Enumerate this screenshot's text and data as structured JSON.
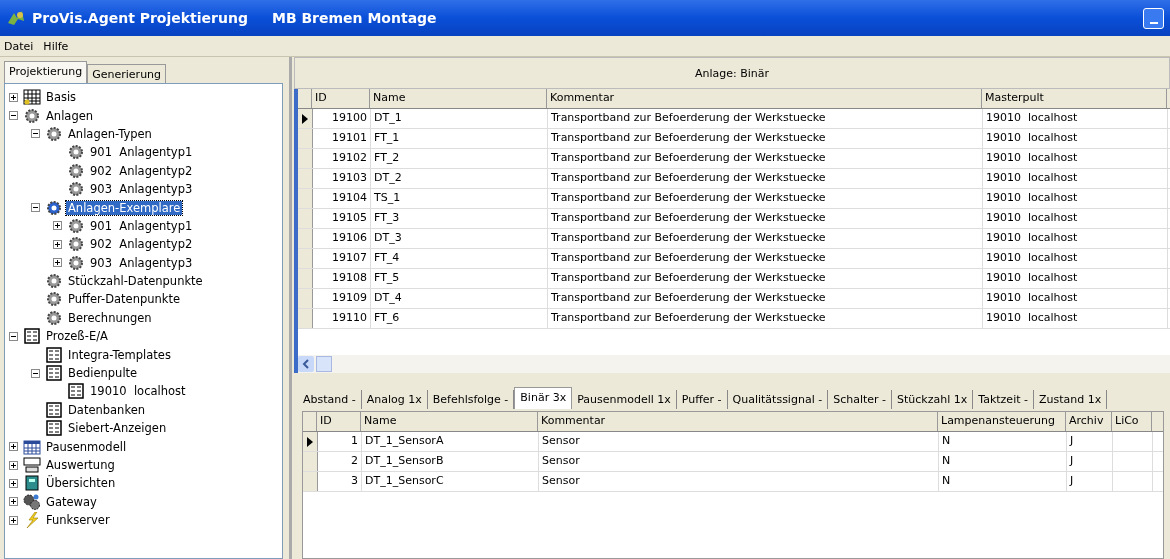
{
  "window": {
    "title": "ProVis.Agent Projektierung",
    "subtitle": "MB Bremen Montage"
  },
  "menu": [
    "Datei",
    "Hilfe"
  ],
  "left_tabs": [
    {
      "label": "Projektierung",
      "selected": true
    },
    {
      "label": "Generierung",
      "selected": false
    }
  ],
  "tree": [
    {
      "label": "Basis",
      "kind": "grid",
      "expanded": false,
      "selected": false
    },
    {
      "label": "Anlagen",
      "kind": "gear",
      "expanded": true,
      "selected": false,
      "children": [
        {
          "label": "Anlagen-Typen",
          "kind": "gear",
          "expanded": true,
          "selected": false,
          "children": [
            {
              "label": "901  Anlagentyp1",
              "kind": "gear",
              "selected": false
            },
            {
              "label": "902  Anlagentyp2",
              "kind": "gear",
              "selected": false
            },
            {
              "label": "903  Anlagentyp3",
              "kind": "gear",
              "selected": false
            }
          ]
        },
        {
          "label": "Anlagen-Exemplare",
          "kind": "gear",
          "expanded": true,
          "selected": true,
          "children": [
            {
              "label": "901  Anlagentyp1",
              "kind": "gear",
              "expanded": false,
              "selected": false
            },
            {
              "label": "902  Anlagentyp2",
              "kind": "gear",
              "expanded": false,
              "selected": false
            },
            {
              "label": "903  Anlagentyp3",
              "kind": "gear",
              "expanded": false,
              "selected": false
            }
          ]
        },
        {
          "label": "Stückzahl-Datenpunkte",
          "kind": "gear",
          "selected": false
        },
        {
          "label": "Puffer-Datenpunkte",
          "kind": "gear",
          "selected": false
        },
        {
          "label": "Berechnungen",
          "kind": "gear",
          "selected": false
        }
      ]
    },
    {
      "label": "Prozeß-E/A",
      "kind": "list",
      "expanded": true,
      "selected": false,
      "children": [
        {
          "label": "Integra-Templates",
          "kind": "list",
          "selected": false
        },
        {
          "label": "Bedienpulte",
          "kind": "list",
          "expanded": true,
          "selected": false,
          "children": [
            {
              "label": "19010  localhost",
              "kind": "list",
              "selected": false
            }
          ]
        },
        {
          "label": "Datenbanken",
          "kind": "list",
          "selected": false
        },
        {
          "label": "Siebert-Anzeigen",
          "kind": "list",
          "selected": false
        }
      ]
    },
    {
      "label": "Pausenmodell",
      "kind": "calendar",
      "expanded": false,
      "selected": false
    },
    {
      "label": "Auswertung",
      "kind": "terminal",
      "expanded": false,
      "selected": false
    },
    {
      "label": "Übersichten",
      "kind": "book",
      "expanded": false,
      "selected": false
    },
    {
      "label": "Gateway",
      "kind": "network",
      "expanded": false,
      "selected": false
    },
    {
      "label": "Funkserver",
      "kind": "bolt",
      "expanded": false,
      "selected": false
    }
  ],
  "panel_title": "Anlage: Binär",
  "upper_table": {
    "columns": [
      "ID",
      "Name",
      "Kommentar",
      "Masterpult"
    ],
    "rows": [
      {
        "cells": [
          "19100",
          "DT_1",
          "Transportband zur Befoerderung der Werkstuecke",
          "19010  localhost"
        ],
        "selected": true
      },
      {
        "cells": [
          "19101",
          "FT_1",
          "Transportband zur Befoerderung der Werkstuecke",
          "19010  localhost"
        ],
        "selected": false
      },
      {
        "cells": [
          "19102",
          "FT_2",
          "Transportband zur Befoerderung der Werkstuecke",
          "19010  localhost"
        ],
        "selected": false
      },
      {
        "cells": [
          "19103",
          "DT_2",
          "Transportband zur Befoerderung der Werkstuecke",
          "19010  localhost"
        ],
        "selected": false
      },
      {
        "cells": [
          "19104",
          "TS_1",
          "Transportband zur Befoerderung der Werkstuecke",
          "19010  localhost"
        ],
        "selected": false
      },
      {
        "cells": [
          "19105",
          "FT_3",
          "Transportband zur Befoerderung der Werkstuecke",
          "19010  localhost"
        ],
        "selected": false
      },
      {
        "cells": [
          "19106",
          "DT_3",
          "Transportband zur Befoerderung der Werkstuecke",
          "19010  localhost"
        ],
        "selected": false
      },
      {
        "cells": [
          "19107",
          "FT_4",
          "Transportband zur Befoerderung der Werkstuecke",
          "19010  localhost"
        ],
        "selected": false
      },
      {
        "cells": [
          "19108",
          "FT_5",
          "Transportband zur Befoerderung der Werkstuecke",
          "19010  localhost"
        ],
        "selected": false
      },
      {
        "cells": [
          "19109",
          "DT_4",
          "Transportband zur Befoerderung der Werkstuecke",
          "19010  localhost"
        ],
        "selected": false
      },
      {
        "cells": [
          "19110",
          "FT_6",
          "Transportband zur Befoerderung der Werkstuecke",
          "19010  localhost"
        ],
        "selected": false
      }
    ]
  },
  "detail_tabs": [
    {
      "label": "Abstand -",
      "selected": false
    },
    {
      "label": "Analog 1x",
      "selected": false
    },
    {
      "label": "Befehlsfolge -",
      "selected": false
    },
    {
      "label": "Binär 3x",
      "selected": true
    },
    {
      "label": "Pausenmodell 1x",
      "selected": false
    },
    {
      "label": "Puffer -",
      "selected": false
    },
    {
      "label": "Qualitätssignal -",
      "selected": false
    },
    {
      "label": "Schalter -",
      "selected": false
    },
    {
      "label": "Stückzahl 1x",
      "selected": false
    },
    {
      "label": "Taktzeit -",
      "selected": false
    },
    {
      "label": "Zustand 1x",
      "selected": false
    }
  ],
  "lower_table": {
    "columns": [
      "ID",
      "Name",
      "Kommentar",
      "Lampenansteuerung",
      "Archiv",
      "LiCo"
    ],
    "rows": [
      {
        "cells": [
          "1",
          "DT_1_SensorA",
          "Sensor",
          "N",
          "J"
        ],
        "selected": true
      },
      {
        "cells": [
          "2",
          "DT_1_SensorB",
          "Sensor",
          "N",
          "J"
        ],
        "selected": false
      },
      {
        "cells": [
          "3",
          "DT_1_SensorC",
          "Sensor",
          "N",
          "J"
        ],
        "selected": false
      }
    ]
  }
}
